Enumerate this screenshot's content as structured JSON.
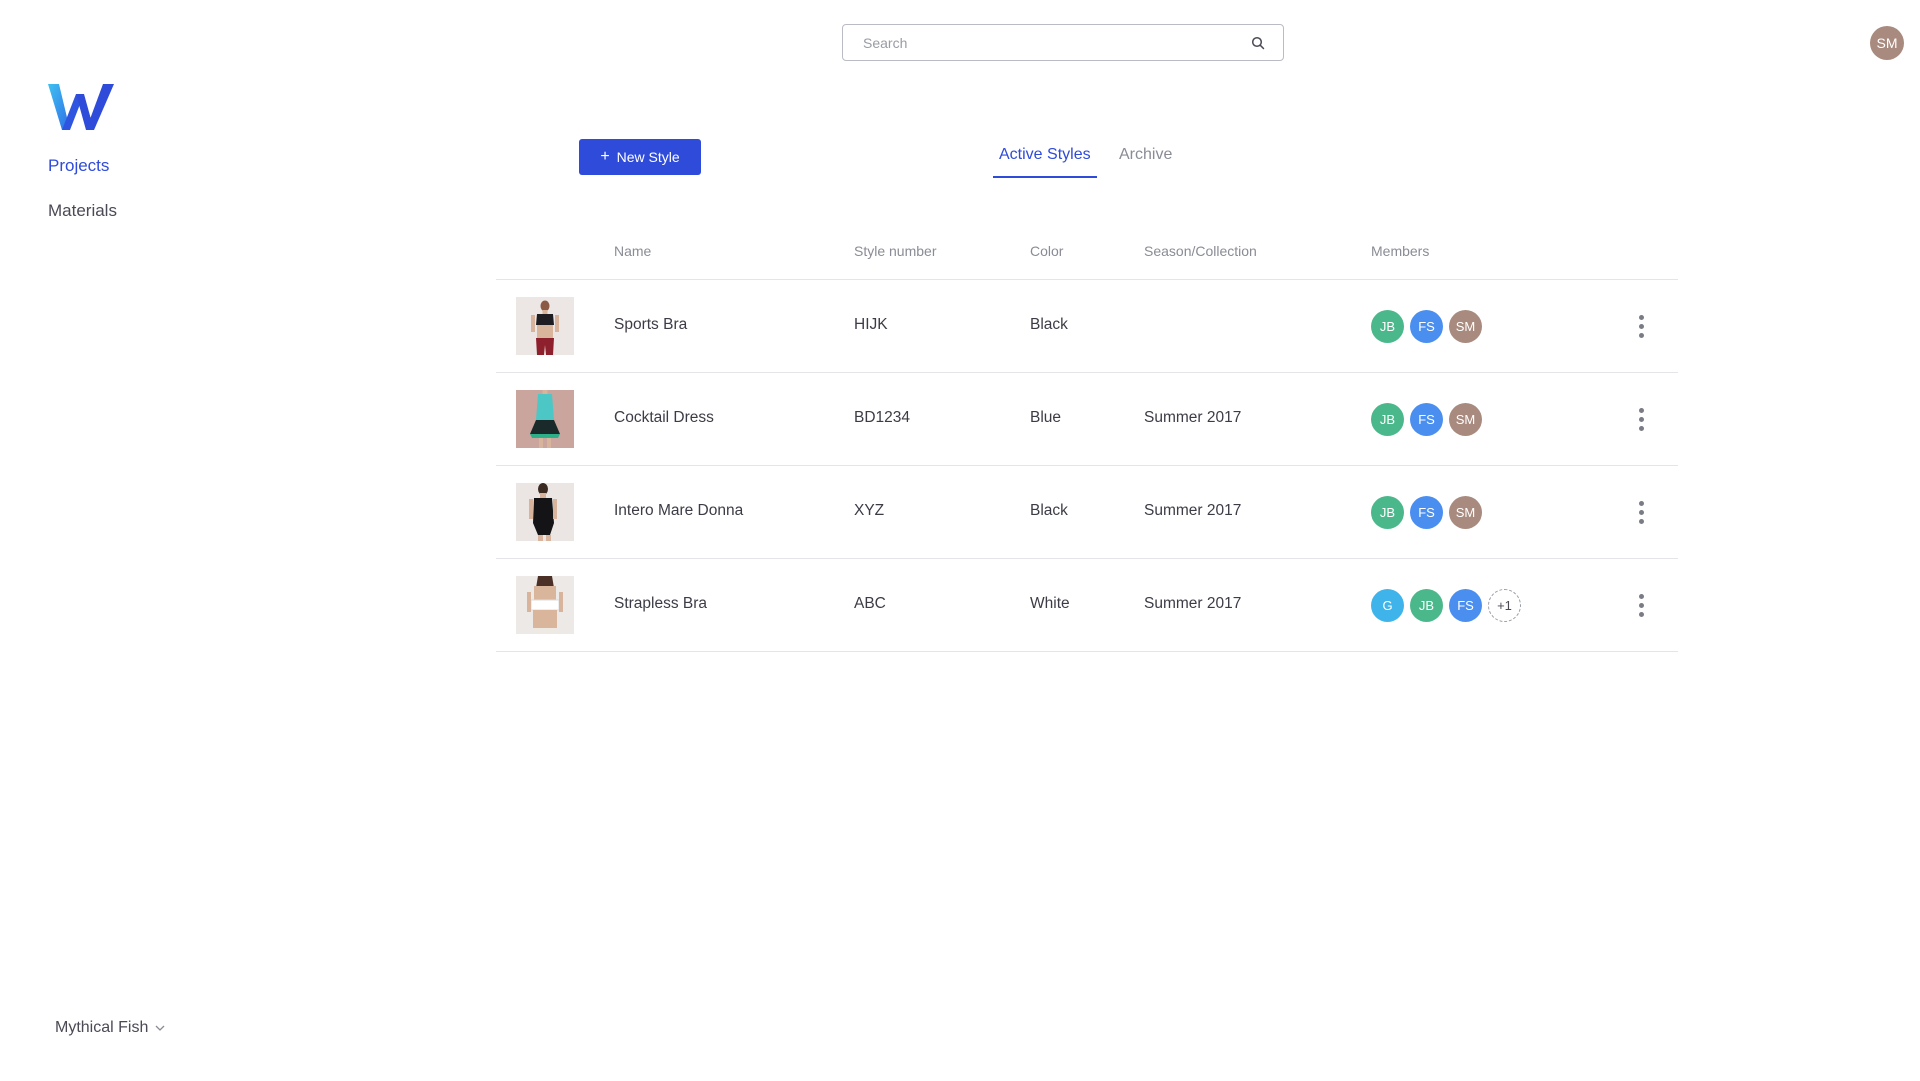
{
  "search": {
    "placeholder": "Search",
    "icon": "search-icon"
  },
  "user": {
    "initials": "SM",
    "color": "#a88a7e"
  },
  "sidebar": {
    "logo": "W",
    "items": [
      {
        "label": "Projects",
        "active": true
      },
      {
        "label": "Materials",
        "active": false
      }
    ],
    "workspace": "Mythical Fish"
  },
  "toolbar": {
    "new_style_label": "New Style"
  },
  "tabs": [
    {
      "label": "Active Styles",
      "active": true
    },
    {
      "label": "Archive",
      "active": false
    }
  ],
  "table": {
    "columns": [
      "Name",
      "Style number",
      "Color",
      "Season/Collection",
      "Members"
    ],
    "rows": [
      {
        "name": "Sports Bra",
        "style_number": "HIJK",
        "color": "Black",
        "season": "",
        "members": [
          {
            "initials": "JB",
            "color": "#4ab88a"
          },
          {
            "initials": "FS",
            "color": "#4a8ef0"
          },
          {
            "initials": "SM",
            "color": "#a88a7e"
          }
        ]
      },
      {
        "name": "Cocktail Dress",
        "style_number": "BD1234",
        "color": "Blue",
        "season": "Summer 2017",
        "members": [
          {
            "initials": "JB",
            "color": "#4ab88a"
          },
          {
            "initials": "FS",
            "color": "#4a8ef0"
          },
          {
            "initials": "SM",
            "color": "#a88a7e"
          }
        ]
      },
      {
        "name": "Intero Mare Donna",
        "style_number": "XYZ",
        "color": "Black",
        "season": "Summer 2017",
        "members": [
          {
            "initials": "JB",
            "color": "#4ab88a"
          },
          {
            "initials": "FS",
            "color": "#4a8ef0"
          },
          {
            "initials": "SM",
            "color": "#a88a7e"
          }
        ]
      },
      {
        "name": "Strapless Bra",
        "style_number": "ABC",
        "color": "White",
        "season": "Summer 2017",
        "members": [
          {
            "initials": "G",
            "color": "#3fb4ea"
          },
          {
            "initials": "JB",
            "color": "#4ab88a"
          },
          {
            "initials": "FS",
            "color": "#4a8ef0"
          }
        ],
        "more_members": "+1"
      }
    ]
  },
  "colors": {
    "accent": "#2f4bd9",
    "divider": "#e4e5e9",
    "muted": "#8a8c95"
  }
}
